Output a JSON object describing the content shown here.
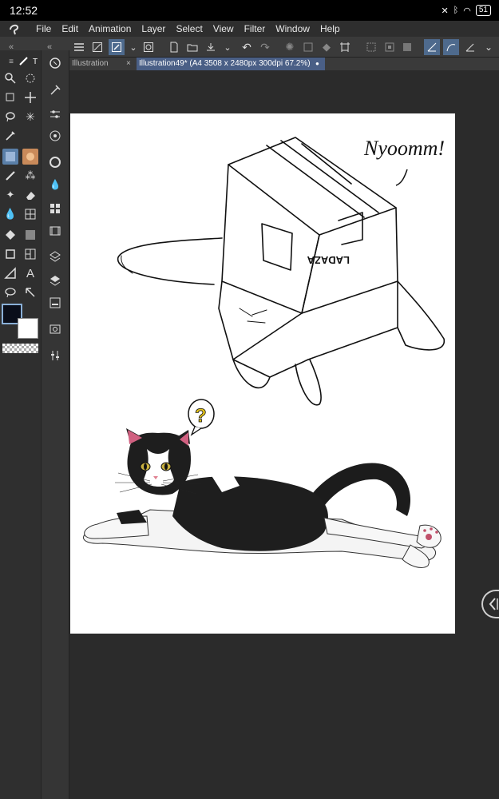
{
  "status": {
    "time": "12:52",
    "battery": "51"
  },
  "menu": [
    "File",
    "Edit",
    "Animation",
    "Layer",
    "Select",
    "View",
    "Filter",
    "Window",
    "Help"
  ],
  "tabs": [
    {
      "label": "Illustration",
      "close": "×"
    },
    {
      "label": "Illustration49* (A4 3508 x 2480px 300dpi 67.2%)",
      "close": "●"
    }
  ],
  "artwork": {
    "speech_text": "Nyoomm!",
    "box_label": "LADAZA",
    "question_mark": "?"
  },
  "side_handle_icon": "panel-toggle-icon"
}
